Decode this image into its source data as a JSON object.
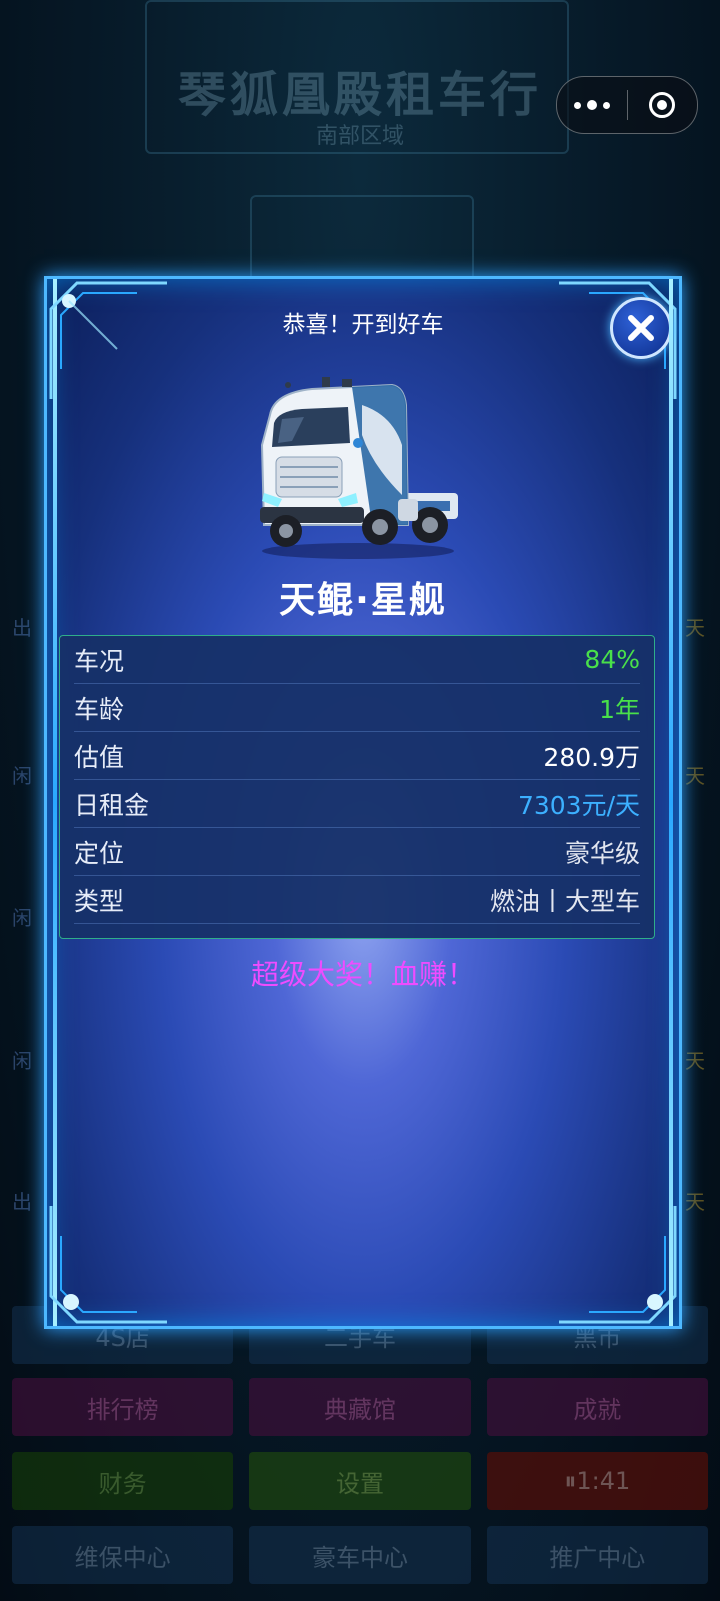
{
  "background": {
    "title": "琴狐凰殿租车行",
    "subtitle": "南部区域",
    "side_left": [
      "出",
      "闲",
      "闲",
      "闲",
      "出"
    ],
    "side_right": [
      "天",
      "天",
      "天",
      "天",
      "天"
    ],
    "menu_rows": [
      [
        "4S店",
        "二手车",
        "黑市"
      ],
      [
        "排行榜",
        "典藏馆",
        "成就"
      ],
      [
        "财务",
        "设置",
        "⏸1:41"
      ],
      [
        "维保中心",
        "豪车中心",
        "推广中心"
      ]
    ]
  },
  "capsule": {
    "more_icon": "more-dots-icon",
    "close_icon": "target-close-icon"
  },
  "modal": {
    "title": "恭喜！开到好车",
    "car_name": "天鲲·星舰",
    "stats": [
      {
        "label": "车况",
        "value": "84%",
        "color": "#49e04a"
      },
      {
        "label": "车龄",
        "value": "1年",
        "color": "#49e04a"
      },
      {
        "label": "估值",
        "value": "280.9万",
        "color": "#ffffff"
      },
      {
        "label": "日租金",
        "value": "7303元/天",
        "color": "#3cb0ff"
      },
      {
        "label": "定位",
        "value": "豪华级",
        "color": "#e2e6f0"
      },
      {
        "label": "类型",
        "value": "燃油丨大型车",
        "color": "#e2e6f0"
      }
    ],
    "jackpot_text": "超级大奖！血赚！",
    "jackpot_color": "#ee4cff",
    "close_icon": "close-x-icon"
  }
}
